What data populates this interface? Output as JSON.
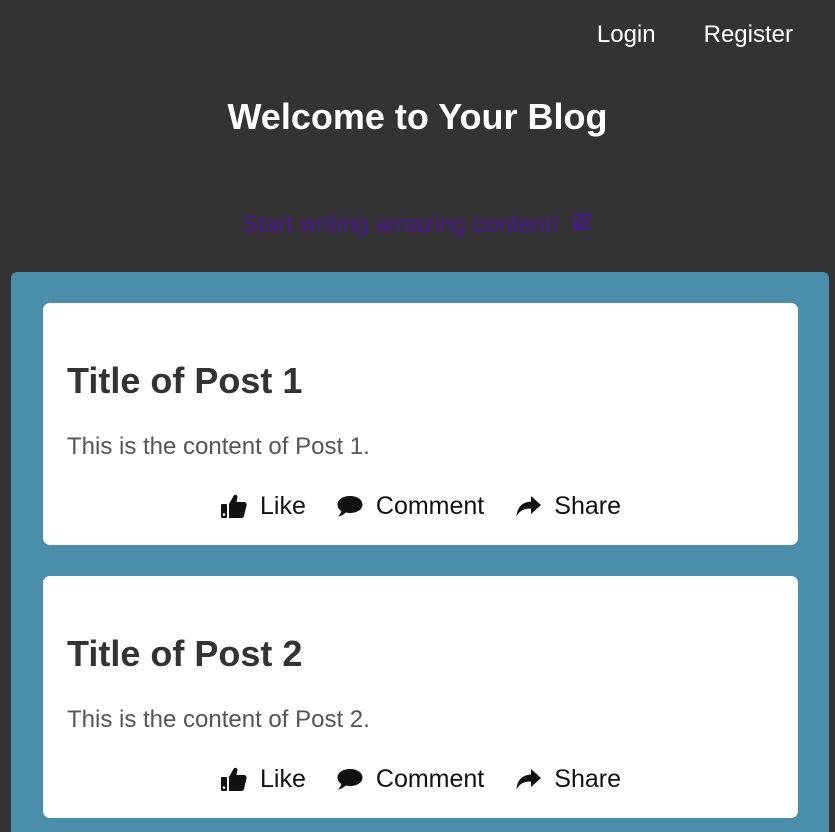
{
  "nav": {
    "login": "Login",
    "register": "Register"
  },
  "header": {
    "title": "Welcome to Your Blog",
    "tagline": "Start writing amazing content!"
  },
  "colors": {
    "header_bg": "#333333",
    "panel_bg": "#4a8eac",
    "tagline": "#4b1791",
    "card_bg": "#ffffff"
  },
  "posts": [
    {
      "title": "Title of Post 1",
      "content": "This is the content of Post 1.",
      "actions": {
        "like": "Like",
        "comment": "Comment",
        "share": "Share"
      }
    },
    {
      "title": "Title of Post 2",
      "content": "This is the content of Post 2.",
      "actions": {
        "like": "Like",
        "comment": "Comment",
        "share": "Share"
      }
    }
  ],
  "icons": {
    "like": "thumbs-up-icon",
    "comment": "comment-icon",
    "share": "share-icon",
    "edit": "edit-icon"
  }
}
